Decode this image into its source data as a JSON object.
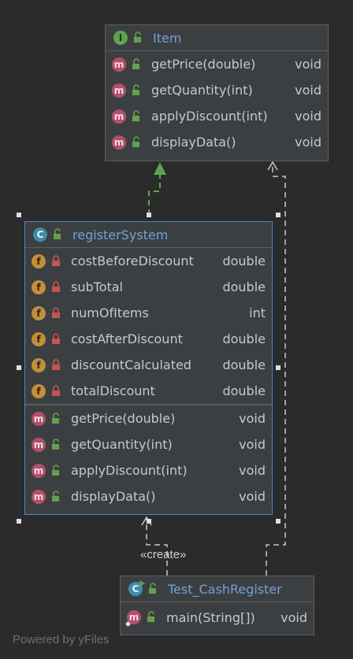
{
  "interface_item": {
    "badge": "I",
    "name": "Item",
    "methods": [
      {
        "badge": "m",
        "name": "getPrice(double)",
        "type": "void"
      },
      {
        "badge": "m",
        "name": "getQuantity(int)",
        "type": "void"
      },
      {
        "badge": "m",
        "name": "applyDiscount(int)",
        "type": "void"
      },
      {
        "badge": "m",
        "name": "displayData()",
        "type": "void"
      }
    ]
  },
  "class_register": {
    "badge": "C",
    "name": "registerSystem",
    "fields": [
      {
        "badge": "f",
        "name": "costBeforeDiscount",
        "type": "double"
      },
      {
        "badge": "f",
        "name": "subTotal",
        "type": "double"
      },
      {
        "badge": "f",
        "name": "numOfItems",
        "type": "int"
      },
      {
        "badge": "f",
        "name": "costAfterDiscount",
        "type": "double"
      },
      {
        "badge": "f",
        "name": "discountCalculated",
        "type": "double"
      },
      {
        "badge": "f",
        "name": "totalDiscount",
        "type": "double"
      }
    ],
    "methods": [
      {
        "badge": "m",
        "name": "getPrice(double)",
        "type": "void"
      },
      {
        "badge": "m",
        "name": "getQuantity(int)",
        "type": "void"
      },
      {
        "badge": "m",
        "name": "applyDiscount(int)",
        "type": "void"
      },
      {
        "badge": "m",
        "name": "displayData()",
        "type": "void"
      }
    ]
  },
  "class_test": {
    "badge": "C",
    "name": "Test_CashRegister",
    "methods": [
      {
        "badge": "m",
        "name": "main(String[])",
        "type": "void"
      }
    ]
  },
  "edges": {
    "create_label": "«create»"
  },
  "watermark": "Powered by yFiles",
  "colors": {
    "background": "#2b2b2b",
    "box": "#3c3f41",
    "header_text": "#6fa2d6",
    "selection": "#4a88c7",
    "implements_edge": "#62a24f"
  }
}
